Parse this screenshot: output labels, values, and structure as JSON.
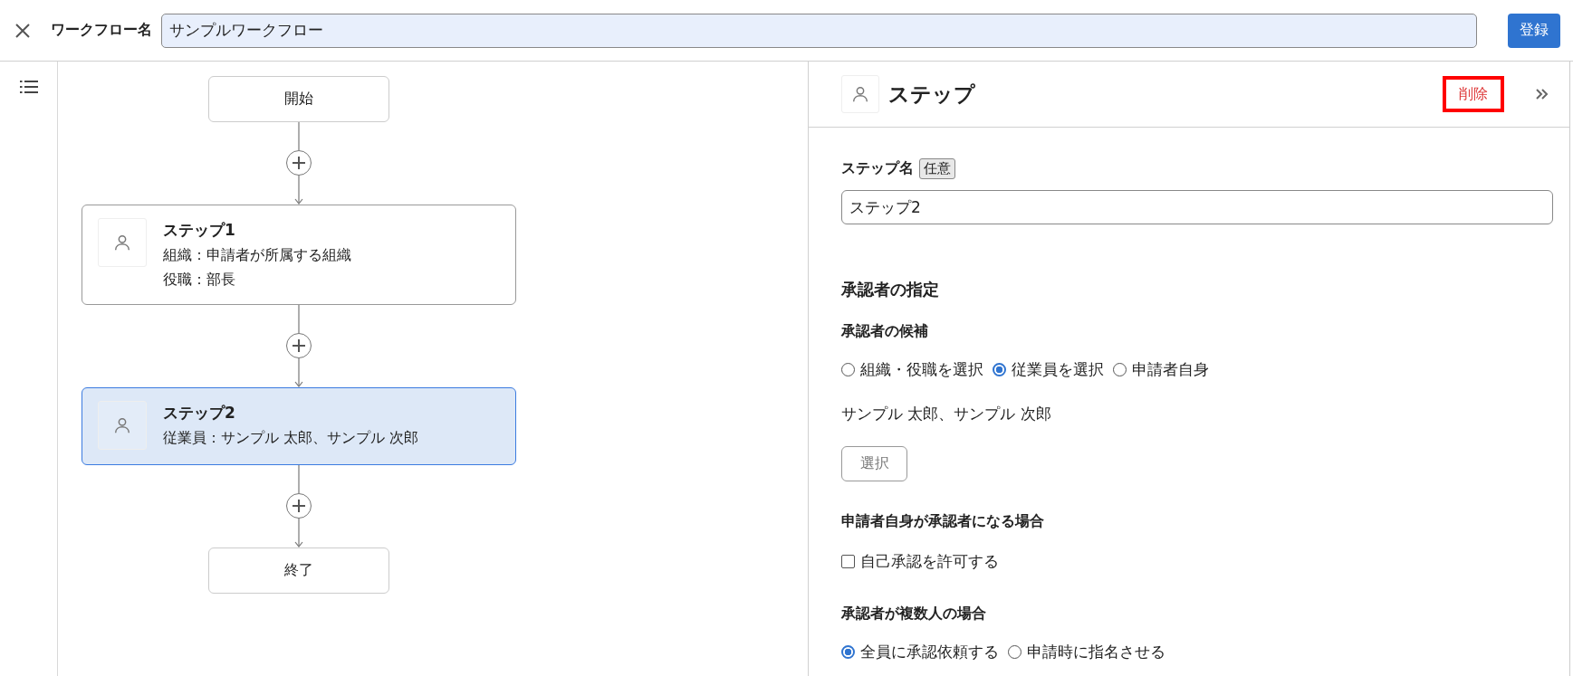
{
  "header": {
    "name_label": "ワークフロー名",
    "name_value": "サンプルワークフロー",
    "register_button": "登録"
  },
  "flow": {
    "nodes": [
      {
        "kind": "terminal",
        "title": "開始",
        "selected": false
      },
      {
        "kind": "step",
        "title": "ステップ1",
        "lines": [
          "組織：申請者が所属する組織",
          "役職：部長"
        ],
        "selected": false
      },
      {
        "kind": "step",
        "title": "ステップ2",
        "lines": [
          "従業員：サンプル 太郎、サンプル 次郎"
        ],
        "selected": true
      },
      {
        "kind": "terminal",
        "title": "終了",
        "selected": false
      }
    ]
  },
  "panel": {
    "title": "ステップ",
    "delete_button": {
      "label": "削除",
      "highlighted": true
    },
    "step_name": {
      "label": "ステップ名",
      "badge": "任意",
      "value": "ステップ2"
    },
    "section_title": "承認者の指定",
    "candidates": {
      "label": "承認者の候補",
      "options": [
        {
          "label": "組織・役職を選択",
          "selected": false
        },
        {
          "label": "従業員を選択",
          "selected": true
        },
        {
          "label": "申請者自身",
          "selected": false
        }
      ]
    },
    "selected_names": "サンプル 太郎、サンプル 次郎",
    "select_button": "選択",
    "self_approval": {
      "label": "申請者自身が承認者になる場合",
      "checkbox": {
        "label": "自己承認を許可する",
        "checked": false
      }
    },
    "multiple": {
      "label": "承認者が複数人の場合",
      "options": [
        {
          "label": "全員に承認依頼する",
          "selected": true
        },
        {
          "label": "申請時に指名させる",
          "selected": false
        }
      ]
    }
  }
}
